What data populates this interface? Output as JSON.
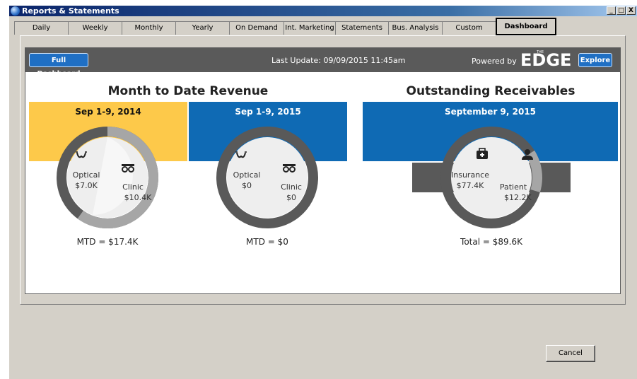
{
  "window": {
    "title": "Reports & Statements",
    "controls": [
      "_",
      "□",
      "X"
    ]
  },
  "tabs": [
    "Daily",
    "Weekly",
    "Monthly",
    "Yearly",
    "On Demand",
    "Int. Marketing",
    "Statements",
    "Bus. Analysis",
    "Custom",
    "Dashboard"
  ],
  "active_tab": "Dashboard",
  "dashboard": {
    "full_dashboard_label": "Full Dashboard",
    "last_update": "Last Update: 09/09/2015 11:45am",
    "powered_by": "Powered by",
    "brand": {
      "the": "THE",
      "name": "EDGE",
      "reg": "®"
    },
    "explore_label": "Explore",
    "revenue": {
      "title": "Month to Date Revenue",
      "periods": [
        {
          "label": "Sep 1-9, 2014",
          "color": "#fdc94a",
          "optical_label": "Optical",
          "optical_value": "$7.0K",
          "optical_share": 0.4,
          "clinic_label": "Clinic",
          "clinic_value": "$10.4K",
          "total": "MTD = $17.4K"
        },
        {
          "label": "Sep 1-9, 2015",
          "color": "#0f6ab4",
          "optical_label": "Optical",
          "optical_value": "$0",
          "optical_share": 0,
          "clinic_label": "Clinic",
          "clinic_value": "$0",
          "total": "MTD = $0"
        }
      ]
    },
    "receivables": {
      "title": "Outstanding Receivables",
      "date_label": "September 9, 2015",
      "color": "#0f6ab4",
      "insurance_label": "Insurance",
      "insurance_value": "$77.4K",
      "insurance_share": 0.864,
      "patient_label": "Patient",
      "patient_value": "$12.2K",
      "total": "Total = $89.6K"
    }
  },
  "cancel_label": "Cancel",
  "colors": {
    "dark_ring": "#595959",
    "light_ring": "#a6a6a6",
    "inner": "#eeeeee",
    "bar": "#5a5a5a",
    "button_blue": "#1f6fc4"
  },
  "icons": [
    "glasses-icon",
    "phoropter-icon",
    "medkit-icon",
    "person-icon"
  ]
}
